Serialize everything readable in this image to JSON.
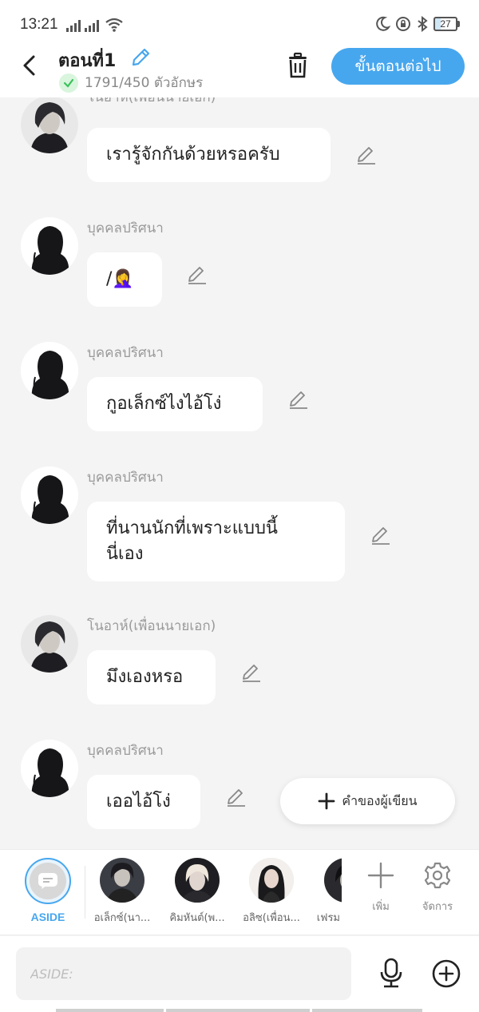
{
  "status_bar": {
    "time": "13:21",
    "battery": "27"
  },
  "header": {
    "title": "ตอนที่1",
    "char_count": "1791/450 ตัวอักษร",
    "next_button": "ขั้นตอนต่อไป"
  },
  "messages": [
    {
      "speaker": "โนอาห์(เพื่อนนายเอก)",
      "text": "เรารู้จักกันด้วยหรอครับ",
      "avatar": "noah"
    },
    {
      "speaker": "บุคคลปริศนา",
      "text": "/🤦‍♀️",
      "avatar": "mystery"
    },
    {
      "speaker": "บุคคลปริศนา",
      "text": "กูอเล็กซ์ไงไอ้โง่",
      "avatar": "mystery"
    },
    {
      "speaker": "บุคคลปริศนา",
      "text": "ที่นานนักที่เพราะแบบนี้\nนี่เอง",
      "avatar": "mystery"
    },
    {
      "speaker": "โนอาห์(เพื่อนนายเอก)",
      "text": "มึงเองหรอ",
      "avatar": "noah"
    },
    {
      "speaker": "บุคคลปริศนา",
      "text": "เออไอ้โง่",
      "avatar": "mystery"
    }
  ],
  "author_note_button": "คำของผู้เขียน",
  "characters": {
    "aside_label": "ASIDE",
    "items": [
      {
        "name": "อเล็กซ์(นา..."
      },
      {
        "name": "คิมหันต์(พ..."
      },
      {
        "name": "อลิซ(เพื่อน..."
      },
      {
        "name": "เฟรม"
      }
    ],
    "add_label": "เพิ่ม",
    "manage_label": "จัดการ"
  },
  "input": {
    "placeholder": "ASIDE:"
  },
  "colors": {
    "accent": "#47a7ee",
    "check_green": "#3cc15a",
    "background": "#f4f4f4"
  }
}
